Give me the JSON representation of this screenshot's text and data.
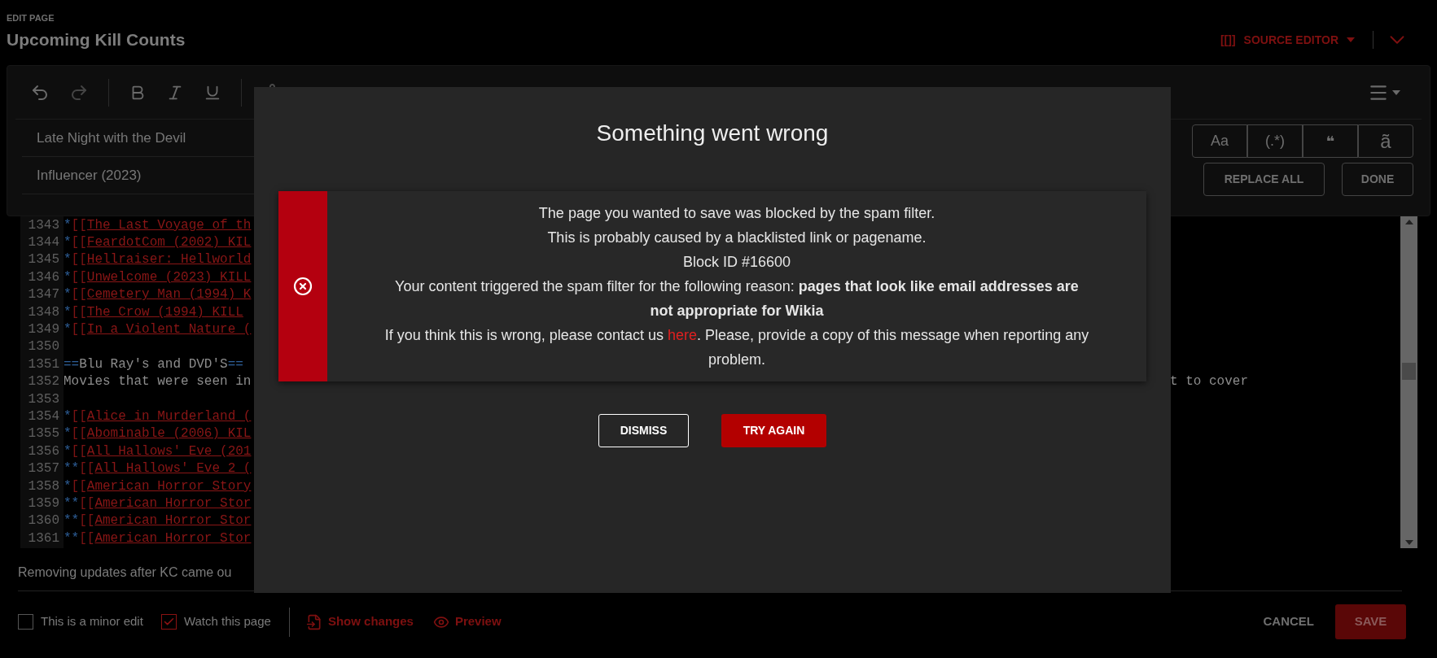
{
  "header": {
    "eyebrow": "EDIT PAGE",
    "title": "Upcoming Kill Counts",
    "mode_button": {
      "icon_text": "[[]]",
      "label": "SOURCE EDITOR"
    }
  },
  "find_replace": {
    "find_value": "Late Night with the Devil",
    "replace_value": "Influencer (2023)",
    "options": [
      {
        "label": "Aa",
        "selected": false
      },
      {
        "label": "(.*)",
        "selected": false
      },
      {
        "label": "❝",
        "selected": false
      },
      {
        "label": "ã",
        "selected": false
      }
    ],
    "buttons": [
      "REPLACE ALL",
      "DONE"
    ]
  },
  "code": {
    "lines": [
      {
        "number": "1343",
        "kind": "link",
        "prefix": "*",
        "open": "[[",
        "text": "The Last Voyage of th"
      },
      {
        "number": "1344",
        "kind": "link",
        "prefix": "*",
        "open": "[[",
        "text": "FeardotCom (2002) KIL"
      },
      {
        "number": "1345",
        "kind": "link",
        "prefix": "*",
        "open": "[[",
        "text": "Hellraiser: Hellworld"
      },
      {
        "number": "1346",
        "kind": "link",
        "prefix": "*",
        "open": "[[",
        "text": "Unwelcome (2023) KILL"
      },
      {
        "number": "1347",
        "kind": "link",
        "prefix": "*",
        "open": "[[",
        "text": "Cemetery Man (1994) K"
      },
      {
        "number": "1348",
        "kind": "link",
        "prefix": "*",
        "open": "[[",
        "text": "The Crow (1994) KILL"
      },
      {
        "number": "1349",
        "kind": "link",
        "prefix": "*",
        "open": "[[",
        "text": "In a Violent Nature ("
      },
      {
        "number": "1350",
        "kind": "blank"
      },
      {
        "number": "1351",
        "kind": "heading",
        "open": "==",
        "text": "Blu Ray's and DVD'S",
        "close": "=="
      },
      {
        "number": "1352",
        "kind": "plain",
        "text": "Movies that were seen in",
        "tail": "t to cover"
      },
      {
        "number": "1353",
        "kind": "blank"
      },
      {
        "number": "1354",
        "kind": "link",
        "prefix": "*",
        "open": "[[",
        "text": "Alice in Murderland ("
      },
      {
        "number": "1355",
        "kind": "link",
        "prefix": "*",
        "open": "[[",
        "text": "Abominable (2006) KIL"
      },
      {
        "number": "1356",
        "kind": "link",
        "prefix": "*",
        "open": "[[",
        "text": "All Hallows' Eve (201"
      },
      {
        "number": "1357",
        "kind": "link",
        "prefix": "**",
        "open": "[[",
        "text": "All Hallows' Eve 2 ("
      },
      {
        "number": "1358",
        "kind": "link",
        "prefix": "*",
        "open": "[[",
        "text": "American Horror Story"
      },
      {
        "number": "1359",
        "kind": "link",
        "prefix": "**",
        "open": "[[",
        "text": "American Horror Stor"
      },
      {
        "number": "1360",
        "kind": "link",
        "prefix": "**",
        "open": "[[",
        "text": "American Horror Stor"
      },
      {
        "number": "1361",
        "kind": "link",
        "prefix": "**",
        "open": "[[",
        "text": "American Horror Stor"
      }
    ]
  },
  "summary": "Removing updates after KC came ou",
  "footer": {
    "checkboxes": [
      {
        "label": "This is a minor edit",
        "checked": false
      },
      {
        "label": "Watch this page",
        "checked": true
      }
    ],
    "links": [
      {
        "kind": "changes",
        "label": "Show changes"
      },
      {
        "kind": "preview",
        "label": "Preview"
      }
    ],
    "cancel": "CANCEL",
    "save": "SAVE"
  },
  "dialog": {
    "title": "Something went wrong",
    "message": [
      "The page you wanted to save was blocked by the spam filter.",
      "This is probably caused by a blacklisted link or pagename.",
      "Block ID #16600",
      "Your content triggered the spam filter for the following reason: **pages that look like email addresses are not appropriate for Wikia**"
    ],
    "contact": {
      "before": "If you think this is wrong, please contact us ",
      "link": "here",
      "after": ". Please, provide a copy of this message when reporting any problem."
    },
    "buttons": [
      {
        "kind": "secondary",
        "label": "DISMISS"
      },
      {
        "kind": "primary",
        "label": "TRY AGAIN"
      }
    ]
  }
}
